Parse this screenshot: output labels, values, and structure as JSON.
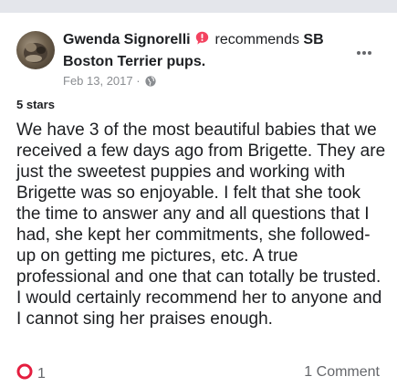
{
  "post": {
    "author": "Gwenda Signorelli",
    "action": "recommends",
    "page_name": "SB Boston Terrier pups.",
    "date": "Feb 13, 2017",
    "separator": "·",
    "rating": "5 stars",
    "review_text": "We have 3 of the most beautiful babies that we received a few days ago from Brigette.  They are just the sweetest puppies and working with Brigette was so enjoyable.  I felt that she took the time to answer any and all questions that I had, she kept her commitments, she followed-up on getting me pictures, etc.  A true professional and one that can totally be trusted.  I would certainly recommend her to anyone and I cannot sing her praises enough."
  },
  "footer": {
    "reaction_count": "1",
    "comments": "1 Comment"
  },
  "icons": {
    "recommend": "recommend-icon",
    "audience": "globe-icon",
    "more": "more-options-icon",
    "reaction": "heart-reaction-icon"
  },
  "colors": {
    "recommend_icon": "#f3425f",
    "reaction_ring": "#e41e3f",
    "meta_text": "#8a8d91",
    "secondary_text": "#65676b"
  }
}
